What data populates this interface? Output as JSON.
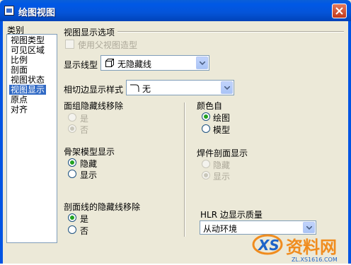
{
  "window": {
    "title": "绘图视图"
  },
  "sidebar": {
    "label": "类别",
    "items": [
      "视图类型",
      "可见区域",
      "比例",
      "剖面",
      "视图状态",
      "视图显示",
      "原点",
      "对齐"
    ],
    "selected_index": 5
  },
  "main": {
    "section_title": "视图显示选项",
    "use_parent_style": {
      "label": "使用父视图造型",
      "checked": false,
      "enabled": false
    },
    "display_style": {
      "label": "显示线型",
      "value": "无隐藏线"
    },
    "tangent_edge": {
      "label": "相切边显示样式",
      "value": "无"
    },
    "face_group_hidden_line": {
      "title": "面组隐藏线移除",
      "options": [
        "是",
        "否"
      ],
      "selected": "否",
      "enabled": false
    },
    "color_from": {
      "title": "颜色自",
      "options": [
        "绘图",
        "模型"
      ],
      "selected": "绘图"
    },
    "skeleton_display": {
      "title": "骨架模型显示",
      "options": [
        "隐藏",
        "显示"
      ],
      "selected": "隐藏"
    },
    "weld_section_display": {
      "title": "焊件剖面显示",
      "options": [
        "隐藏",
        "显示"
      ],
      "selected": "显示",
      "enabled": false
    },
    "section_hidden_line": {
      "title": "剖面线的隐藏线移除",
      "options": [
        "是",
        "否"
      ],
      "selected": "是"
    },
    "hlr_quality": {
      "label": "HLR 边显示质量",
      "value": "从动环境"
    }
  },
  "watermark": {
    "brand": "资料网",
    "url": "ZL.XS1616.COM",
    "logo_text": "XS"
  },
  "colors": {
    "title_bar": "#0054E3",
    "selection": "#316AC5",
    "dialog_bg": "#ECE9D8",
    "radio_dot": "#21A121"
  }
}
